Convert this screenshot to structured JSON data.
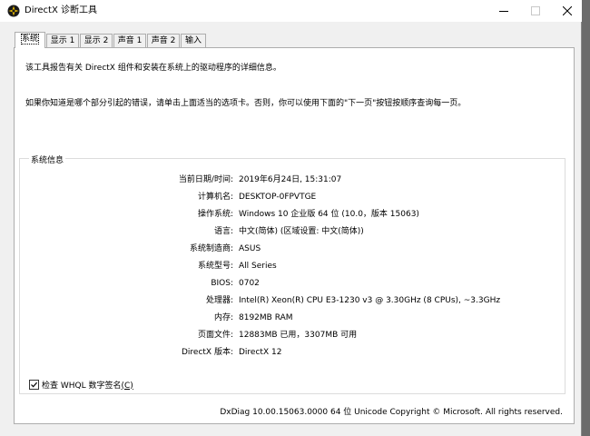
{
  "window": {
    "title": "DirectX 诊断工具"
  },
  "tabs": [
    {
      "label": "系统",
      "active": true
    },
    {
      "label": "显示 1"
    },
    {
      "label": "显示 2"
    },
    {
      "label": "声音 1"
    },
    {
      "label": "声音 2"
    },
    {
      "label": "输入"
    }
  ],
  "intro": {
    "line1": "该工具报告有关 DirectX 组件和安装在系统上的驱动程序的详细信息。",
    "line2": "如果你知道是哪个部分引起的错误，请单击上面适当的选项卡。否则，你可以使用下面的\"下一页\"按钮按顺序查询每一页。"
  },
  "system_info": {
    "legend": "系统信息",
    "rows": [
      {
        "label": "当前日期/时间:",
        "value": "2019年6月24日, 15:31:07"
      },
      {
        "label": "计算机名:",
        "value": "DESKTOP-0FPVTGE"
      },
      {
        "label": "操作系统:",
        "value": "Windows 10 企业版 64 位 (10.0，版本 15063)"
      },
      {
        "label": "语言:",
        "value": "中文(简体) (区域设置: 中文(简体))"
      },
      {
        "label": "系统制造商:",
        "value": "ASUS"
      },
      {
        "label": "系统型号:",
        "value": "All Series"
      },
      {
        "label": "BIOS:",
        "value": "0702"
      },
      {
        "label": "处理器:",
        "value": "Intel(R) Xeon(R) CPU E3-1230 v3 @ 3.30GHz (8 CPUs), ~3.3GHz"
      },
      {
        "label": "内存:",
        "value": "8192MB RAM"
      },
      {
        "label": "页面文件:",
        "value": "12883MB 已用，3307MB 可用"
      },
      {
        "label": "DirectX 版本:",
        "value": "DirectX 12"
      }
    ]
  },
  "whql": {
    "label": "检查 WHQL 数字签名",
    "accel": "(C)",
    "checked": true
  },
  "footer": "DxDiag 10.00.15063.0000 64 位 Unicode  Copyright © Microsoft. All rights reserved.",
  "colors": {
    "window_bg": "#f0f0f0",
    "panel_bg": "#ffffff",
    "border": "#adadad"
  }
}
